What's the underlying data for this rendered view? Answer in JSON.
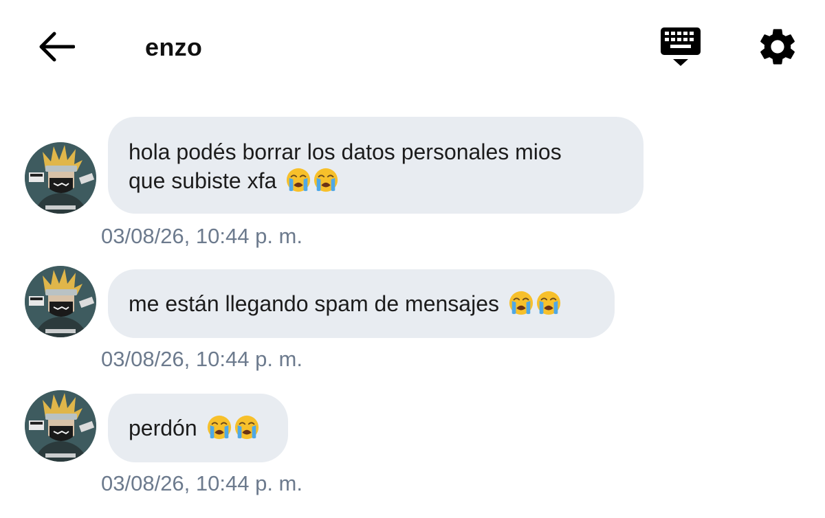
{
  "header": {
    "title": "enzo",
    "back_icon": "arrow-left-icon",
    "keyboard_icon": "keyboard-hide-icon",
    "settings_icon": "gear-icon"
  },
  "messages": [
    {
      "text_line1": "hola podés borrar los datos personales mios",
      "text_line2": "que subiste xfa",
      "emojis": [
        "loudly-crying-face",
        "loudly-crying-face"
      ],
      "timestamp": "03/08/26, 10:44 p. m."
    },
    {
      "text": "me están llegando spam de mensajes",
      "emojis": [
        "loudly-crying-face",
        "loudly-crying-face"
      ],
      "timestamp": "03/08/26, 10:44 p. m."
    },
    {
      "text": "perdón",
      "emojis": [
        "loudly-crying-face",
        "loudly-crying-face"
      ],
      "timestamp": "03/08/26, 10:44 p. m."
    }
  ],
  "colors": {
    "bubble": "#e8ecf1",
    "timestamp": "#6c7a8d",
    "icon": "#000000"
  }
}
